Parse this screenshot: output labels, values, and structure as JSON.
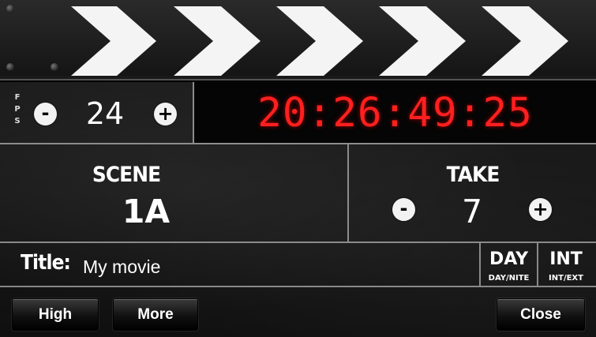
{
  "fps": {
    "label": "FPS",
    "label_letters": [
      "F",
      "P",
      "S"
    ],
    "value": "24",
    "minus_icon": "minus-icon",
    "plus_icon": "plus-icon",
    "minus_glyph": "-",
    "plus_glyph": "+"
  },
  "timecode": {
    "value": "20:26:49:25",
    "color": "#ff1f1f"
  },
  "scene": {
    "label": "SCENE",
    "value": "1A"
  },
  "take": {
    "label": "TAKE",
    "value": "7",
    "minus_glyph": "-",
    "plus_glyph": "+"
  },
  "title": {
    "label": "Title:",
    "value": "My movie"
  },
  "day_nite": {
    "value": "DAY",
    "caption": "DAY/NITE"
  },
  "int_ext": {
    "value": "INT",
    "caption": "INT/EXT"
  },
  "buttons": {
    "high": "High",
    "more": "More",
    "close": "Close"
  }
}
